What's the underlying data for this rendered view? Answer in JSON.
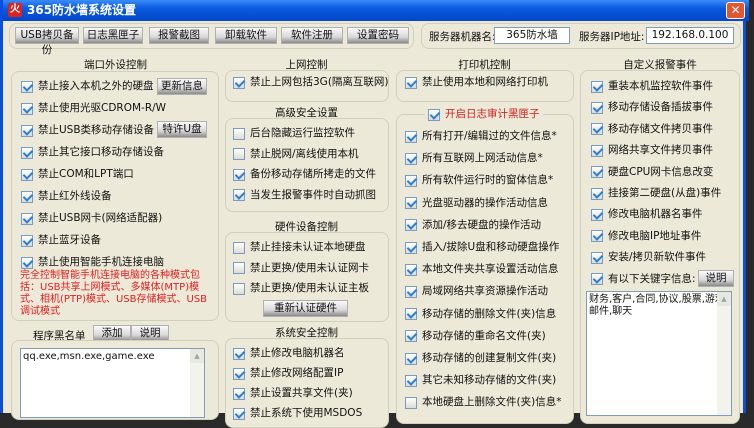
{
  "window": {
    "title": "365防水墙系统设置",
    "close": "✕",
    "app_icon": "火"
  },
  "toolbar": [
    "USB拷贝备份",
    "日志黑匣子",
    "报警截图",
    "卸载软件",
    "软件注册",
    "设置密码"
  ],
  "server": {
    "name_label": "服务器机器名:",
    "name_value": "365防水墙",
    "ip_label": "服务器IP地址:",
    "ip_value": "192.168.0.100"
  },
  "port": {
    "title": "端口外设控制",
    "items": [
      {
        "label": "禁止接入本机之外的硬盘",
        "checked": true
      },
      {
        "label": "禁止使用光驱CDROM-R/W",
        "checked": true
      },
      {
        "label": "禁止USB类移动存储设备",
        "checked": true
      },
      {
        "label": "禁止其它接口移动存储设备",
        "checked": true
      },
      {
        "label": "禁止COM和LPT端口",
        "checked": true
      },
      {
        "label": "禁止红外线设备",
        "checked": true
      },
      {
        "label": "禁止USB网卡(网络适配器)",
        "checked": true
      },
      {
        "label": "禁止蓝牙设备",
        "checked": true
      },
      {
        "label": "禁止使用智能手机连接电脑",
        "checked": true
      }
    ],
    "update_btn": "更新信息",
    "usb_btn": "特许U盘",
    "note": "完全控制智能手机连接电脑的各种模式包括：USB共享上网模式、多媒体(MTP)模式、相机(PTP)模式、USB存储模式、USB调试模式"
  },
  "blacklist": {
    "label": "程序黑名单",
    "add": "添加",
    "help": "说明",
    "value": "qq.exe,msn.exe,game.exe"
  },
  "net": {
    "title": "上网控制",
    "items": [
      {
        "label": "禁止上网包括3G(隔离互联网)",
        "checked": true
      }
    ]
  },
  "adv": {
    "title": "高级安全设置",
    "items": [
      {
        "label": "后台隐藏运行监控软件",
        "checked": false
      },
      {
        "label": "禁止脱网/离线使用本机",
        "checked": false
      },
      {
        "label": "备份移动存储所拷走的文件",
        "checked": true
      },
      {
        "label": "当发生报警事件时自动抓图",
        "checked": true
      }
    ]
  },
  "hw": {
    "title": "硬件设备控制",
    "items": [
      {
        "label": "禁止挂接未认证本地硬盘",
        "checked": false
      },
      {
        "label": "禁止更换/使用未认证网卡",
        "checked": false
      },
      {
        "label": "禁止更换/使用未认证主板",
        "checked": false
      }
    ],
    "reauth": "重新认证硬件"
  },
  "sys": {
    "title": "系统安全控制",
    "items": [
      {
        "label": "禁止修改电脑机器名",
        "checked": true
      },
      {
        "label": "禁止修改网络配置IP",
        "checked": true
      },
      {
        "label": "禁止设置共享文件(夹)",
        "checked": true
      },
      {
        "label": "禁止系统下使用MSDOS",
        "checked": true
      }
    ]
  },
  "printer": {
    "title": "打印机控制",
    "items": [
      {
        "label": "禁止使用本地和网络打印机",
        "checked": true
      }
    ]
  },
  "audit": {
    "title": "开启日志审计黑匣子",
    "checked": true,
    "items": [
      {
        "label": "所有打开/编辑过的文件信息*",
        "checked": true
      },
      {
        "label": "所有互联网上网活动信息*",
        "checked": true
      },
      {
        "label": "所有软件运行时的窗体信息*",
        "checked": true
      },
      {
        "label": "光盘驱动器的操作活动信息",
        "checked": true
      },
      {
        "label": "添加/移去硬盘的操作活动",
        "checked": true
      },
      {
        "label": "插入/拔除U盘和移动硬盘操作",
        "checked": true
      },
      {
        "label": "本地文件夹共享设置活动信息",
        "checked": true
      },
      {
        "label": "局域网络共享资源操作活动",
        "checked": true
      },
      {
        "label": "移动存储的删除文件(夹)信息",
        "checked": true
      },
      {
        "label": "移动存储的重命名文件(夹)",
        "checked": true
      },
      {
        "label": "移动存储的创建复制文件(夹)",
        "checked": true
      },
      {
        "label": "其它未知移动存储的文件(夹)",
        "checked": true
      },
      {
        "label": "本地硬盘上删除文件(夹)信息*",
        "checked": false
      }
    ]
  },
  "alarm": {
    "title": "自定义报警事件",
    "items": [
      {
        "label": "重装本机监控软件事件",
        "checked": true
      },
      {
        "label": "移动存储设备插拔事件",
        "checked": true
      },
      {
        "label": "移动存储文件拷贝事件",
        "checked": true
      },
      {
        "label": "网络共享文件拷贝事件",
        "checked": true
      },
      {
        "label": "硬盘CPU网卡信息改变",
        "checked": true
      },
      {
        "label": "挂接第二硬盘(从盘)事件",
        "checked": true
      },
      {
        "label": "修改电脑机器名事件",
        "checked": true
      },
      {
        "label": "修改电脑IP地址事件",
        "checked": true
      },
      {
        "label": "安装/拷贝新软件事件",
        "checked": true
      },
      {
        "label": "有以下关键字信息:",
        "checked": true
      }
    ],
    "help": "说明",
    "keywords": "财务,客户,合同,协议,股票,游戏,邮件,聊天"
  }
}
